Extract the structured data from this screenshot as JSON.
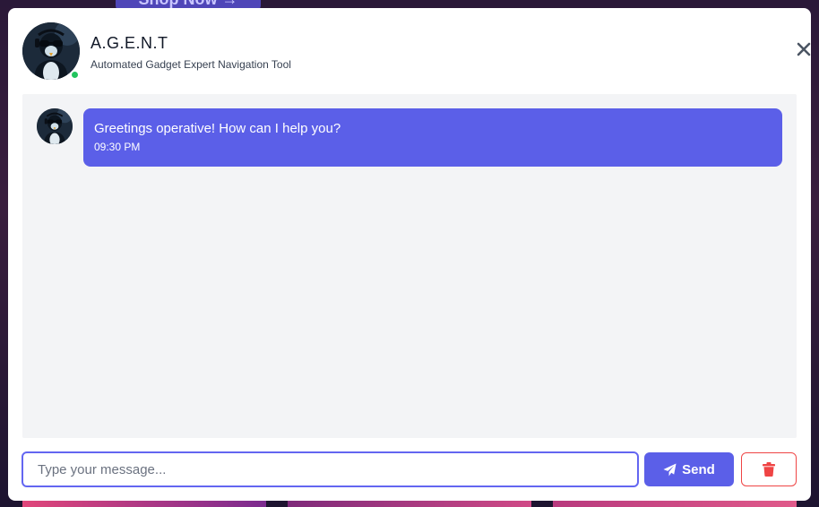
{
  "background": {
    "shop_button_label": "Shop Now →"
  },
  "agent": {
    "name": "A.G.E.N.T",
    "subtitle": "Automated Gadget Expert Navigation Tool",
    "status": "online",
    "status_color": "#22c55e"
  },
  "messages": [
    {
      "sender": "agent",
      "text": "Greetings operative! How can I help you?",
      "time": "09:30 PM"
    }
  ],
  "composer": {
    "placeholder": "Type your message...",
    "value": "",
    "send_label": "Send"
  },
  "icons": {
    "close": "close-icon",
    "send": "paper-plane-icon",
    "clear": "trash-icon"
  },
  "colors": {
    "accent": "#5b5fe8",
    "danger": "#ef4444",
    "chat_bg": "#f3f4f6"
  }
}
